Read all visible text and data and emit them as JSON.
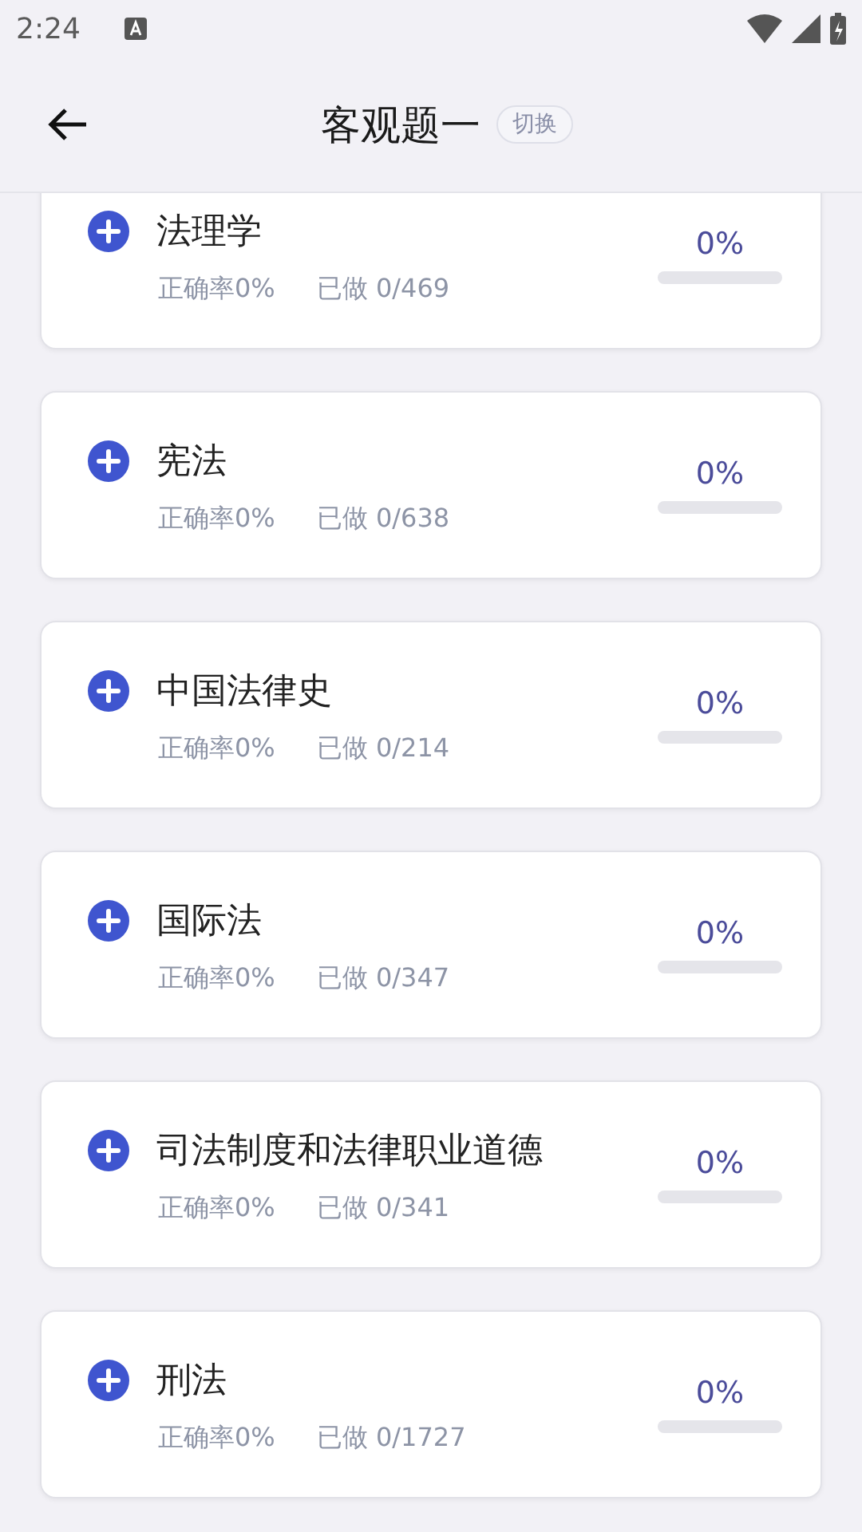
{
  "status_bar": {
    "time": "2:24"
  },
  "header": {
    "title": "客观题一",
    "switch_label": "切换"
  },
  "subjects": [
    {
      "name": "法理学",
      "accuracy": "正确率0%",
      "done": "已做 0/469",
      "percent": "0%",
      "level": 0
    },
    {
      "name": "宪法",
      "accuracy": "正确率0%",
      "done": "已做 0/638",
      "percent": "0%",
      "level": 0
    },
    {
      "name": "中国法律史",
      "accuracy": "正确率0%",
      "done": "已做 0/214",
      "percent": "0%",
      "level": 0
    },
    {
      "name": "国际法",
      "accuracy": "正确率0%",
      "done": "已做 0/347",
      "percent": "0%",
      "level": 0
    },
    {
      "name": "司法制度和法律职业道德",
      "accuracy": "正确率0%",
      "done": "已做 0/341",
      "percent": "0%",
      "level": 0
    },
    {
      "name": "刑法",
      "accuracy": "正确率0%",
      "done": "已做 0/1727",
      "percent": "0%",
      "level": 0
    }
  ]
}
